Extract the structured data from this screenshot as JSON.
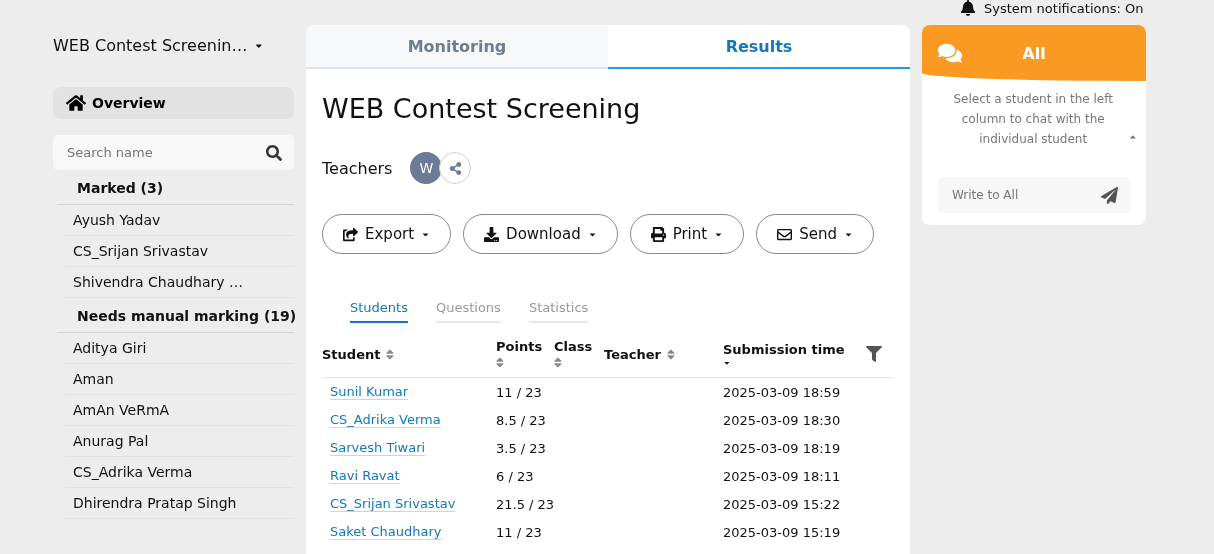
{
  "notification": {
    "label": "System notifications: On"
  },
  "sidebar": {
    "exam_title": "WEB Contest Screenin…",
    "overview": {
      "label": "Overview",
      "selected": true
    },
    "search": {
      "placeholder": "Search name"
    },
    "groups": [
      {
        "title": "Marked (3)",
        "items": [
          "Ayush Yadav",
          "CS_Srijan Srivastav",
          "Shivendra Chaudhary …"
        ]
      },
      {
        "title": "Needs manual marking (19)",
        "items": [
          "Aditya Giri",
          "Aman",
          "AmAn VeRmA",
          "Anurag Pal",
          "CS_Adrika Verma",
          "Dhirendra Pratap Singh"
        ]
      }
    ]
  },
  "steps": [
    {
      "label": "Monitoring",
      "selected": false
    },
    {
      "label": "Results",
      "selected": true
    }
  ],
  "title": "WEB Contest Screening",
  "teachers": {
    "label": "Teachers",
    "avatar": "W"
  },
  "actions": [
    {
      "label": "Export",
      "kind": "export"
    },
    {
      "label": "Download",
      "kind": "download"
    },
    {
      "label": "Print",
      "kind": "print"
    },
    {
      "label": "Send",
      "kind": "send"
    }
  ],
  "tabs": [
    {
      "label": "Students",
      "selected": true
    },
    {
      "label": "Questions",
      "selected": false
    },
    {
      "label": "Statistics",
      "selected": false
    }
  ],
  "table": {
    "columns": [
      {
        "label": "Student",
        "sorted": false
      },
      {
        "label": "Points",
        "sorted": false
      },
      {
        "label": "Class",
        "sorted": false
      },
      {
        "label": "Teacher",
        "sorted": false
      },
      {
        "label": "Submission time",
        "sorted": true
      }
    ],
    "rows": [
      [
        "Sunil Kumar",
        "11 / 23",
        "",
        "",
        "2025-03-09 18:59"
      ],
      [
        "CS_Adrika Verma",
        "8.5 / 23",
        "",
        "",
        "2025-03-09 18:30"
      ],
      [
        "Sarvesh Tiwari",
        "3.5 / 23",
        "",
        "",
        "2025-03-09 18:19"
      ],
      [
        "Ravi Ravat",
        "6 / 23",
        "",
        "",
        "2025-03-09 18:11"
      ],
      [
        "CS_Srijan Srivastav",
        "21.5 / 23",
        "",
        "",
        "2025-03-09 15:22"
      ],
      [
        "Saket Chaudhary",
        "11 / 23",
        "",
        "",
        "2025-03-09 15:19"
      ]
    ]
  },
  "chat": {
    "title": "All",
    "hint": "Select a student in the left column to chat with the individual student",
    "expanded": false,
    "placeholder": "Write to All"
  }
}
